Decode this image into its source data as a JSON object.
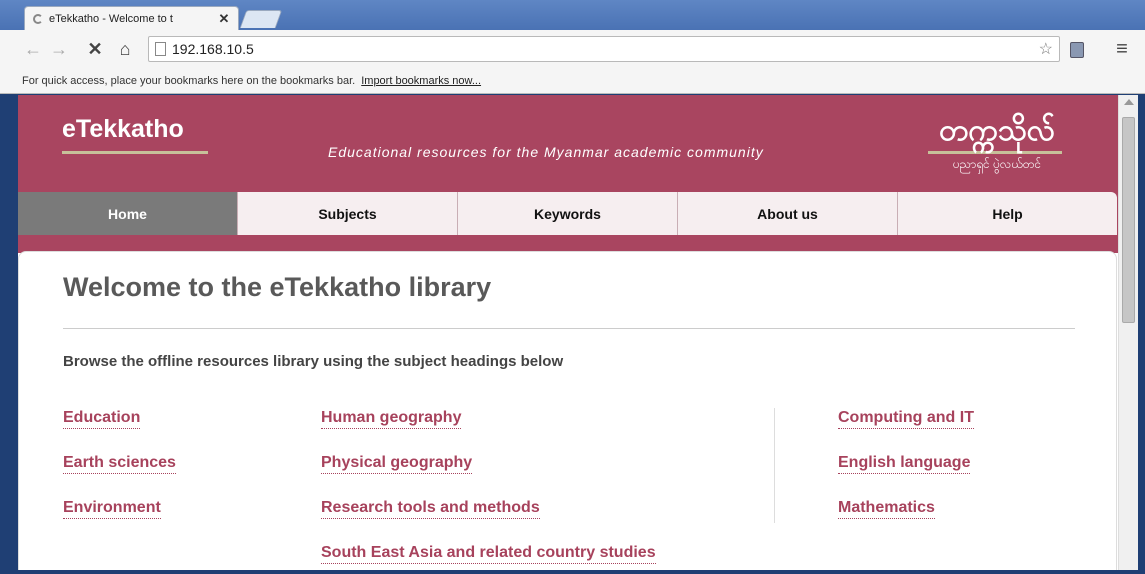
{
  "browser": {
    "tab_title": "eTekkatho - Welcome to t",
    "tab_close": "✕",
    "url": "192.168.10.5",
    "bookmarks_bar_text": "For quick access, place your bookmarks here on the bookmarks bar.",
    "import_bookmarks": "Import bookmarks now...",
    "icons": {
      "back": "←",
      "forward": "→",
      "stop": "✕",
      "home": "⌂",
      "star": "☆",
      "menu": "≡"
    }
  },
  "site": {
    "logo": "eTekkatho",
    "tagline": "Educational resources for the Myanmar academic community",
    "myanmar_title": "တက္ကသိုလ်",
    "myanmar_subtitle": "ပညာရှင် ပွဲလယ်တင်",
    "brand_color": "#a94560",
    "link_color": "#a7425c"
  },
  "nav": [
    {
      "label": "Home",
      "active": true
    },
    {
      "label": "Subjects",
      "active": false
    },
    {
      "label": "Keywords",
      "active": false
    },
    {
      "label": "About us",
      "active": false
    },
    {
      "label": "Help",
      "active": false
    }
  ],
  "main": {
    "heading": "Welcome to the eTekkatho library",
    "intro": "Browse the offline resources library using the subject headings below",
    "subjects": {
      "col1": [
        "Education",
        "Earth sciences",
        "Environment"
      ],
      "col2": [
        "Human geography",
        "Physical geography",
        "Research tools and methods",
        "South East Asia and related country studies"
      ],
      "col3": [
        "Computing and IT",
        "English language",
        "Mathematics"
      ]
    }
  }
}
